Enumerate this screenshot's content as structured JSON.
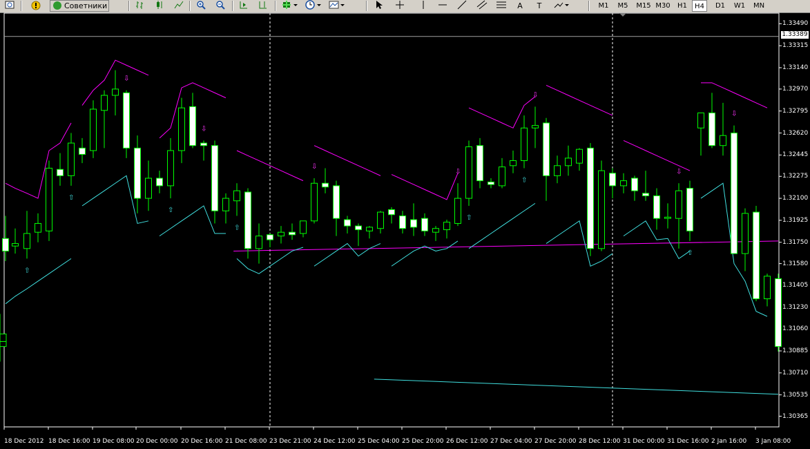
{
  "toolbar": {
    "advisors_label": "Советники",
    "buttons": [
      "zoom-in",
      "zoom-out"
    ],
    "draw_letters": [
      "A",
      "T"
    ],
    "timeframes": [
      {
        "label": "M1",
        "active": false
      },
      {
        "label": "M5",
        "active": false
      },
      {
        "label": "M15",
        "active": false
      },
      {
        "label": "M30",
        "active": false
      },
      {
        "label": "H1",
        "active": false
      },
      {
        "label": "H4",
        "active": true
      },
      {
        "label": "D1",
        "active": false
      },
      {
        "label": "W1",
        "active": false
      },
      {
        "label": "MN",
        "active": false
      }
    ]
  },
  "chart": {
    "bid_label": "1.33389",
    "price_ticks": [
      "1.33490",
      "1.33315",
      "1.33140",
      "1.32970",
      "1.32795",
      "1.32620",
      "1.32445",
      "1.32275",
      "1.32100",
      "1.31925",
      "1.31750",
      "1.31580",
      "1.31405",
      "1.31230",
      "1.31060",
      "1.30885",
      "1.30710",
      "1.30535",
      "1.30365"
    ],
    "time_ticks": [
      "18 Dec 2012",
      "18 Dec 16:00",
      "19 Dec 08:00",
      "20 Dec 00:00",
      "20 Dec 16:00",
      "21 Dec 08:00",
      "23 Dec 21:00",
      "24 Dec 12:00",
      "25 Dec 04:00",
      "25 Dec 20:00",
      "26 Dec 12:00",
      "27 Dec 04:00",
      "27 Dec 20:00",
      "28 Dec 12:00",
      "31 Dec 00:00",
      "31 Dec 16:00",
      "2 Jan 16:00",
      "3 Jan 08:00"
    ],
    "colors": {
      "background": "#000000",
      "candle_body_bull": "#000000",
      "candle_body_bear": "#ffffff",
      "candle_outline": "#00ff00",
      "upper_line": "#ff00ff",
      "lower_line": "#40e0e0",
      "grid": "#ffffff"
    }
  },
  "chart_data": {
    "type": "candlestick",
    "symbol_timeframe": "H4",
    "ylim": [
      1.3028,
      1.3358
    ],
    "bid": 1.33389,
    "candles": [
      {
        "o": 1.3178,
        "h": 1.3196,
        "l": 1.316,
        "c": 1.3168
      },
      {
        "o": 1.3172,
        "h": 1.3186,
        "l": 1.3166,
        "c": 1.3174
      },
      {
        "o": 1.317,
        "h": 1.32,
        "l": 1.3162,
        "c": 1.3182
      },
      {
        "o": 1.3183,
        "h": 1.3198,
        "l": 1.3175,
        "c": 1.319
      },
      {
        "o": 1.3184,
        "h": 1.324,
        "l": 1.3176,
        "c": 1.3234
      },
      {
        "o": 1.3233,
        "h": 1.3246,
        "l": 1.322,
        "c": 1.3228
      },
      {
        "o": 1.3228,
        "h": 1.3262,
        "l": 1.322,
        "c": 1.3254
      },
      {
        "o": 1.325,
        "h": 1.3258,
        "l": 1.3238,
        "c": 1.3245
      },
      {
        "o": 1.3248,
        "h": 1.3288,
        "l": 1.3242,
        "c": 1.3281
      },
      {
        "o": 1.328,
        "h": 1.3296,
        "l": 1.325,
        "c": 1.3292
      },
      {
        "o": 1.3292,
        "h": 1.3312,
        "l": 1.3276,
        "c": 1.3297
      },
      {
        "o": 1.3294,
        "h": 1.3296,
        "l": 1.3242,
        "c": 1.325
      },
      {
        "o": 1.325,
        "h": 1.326,
        "l": 1.3198,
        "c": 1.321
      },
      {
        "o": 1.321,
        "h": 1.324,
        "l": 1.32,
        "c": 1.3226
      },
      {
        "o": 1.3226,
        "h": 1.3232,
        "l": 1.3214,
        "c": 1.322
      },
      {
        "o": 1.322,
        "h": 1.3258,
        "l": 1.321,
        "c": 1.3248
      },
      {
        "o": 1.3248,
        "h": 1.329,
        "l": 1.3238,
        "c": 1.3282
      },
      {
        "o": 1.3283,
        "h": 1.3294,
        "l": 1.325,
        "c": 1.3252
      },
      {
        "o": 1.3254,
        "h": 1.3256,
        "l": 1.324,
        "c": 1.3252
      },
      {
        "o": 1.3252,
        "h": 1.3256,
        "l": 1.319,
        "c": 1.32
      },
      {
        "o": 1.32,
        "h": 1.3214,
        "l": 1.319,
        "c": 1.321
      },
      {
        "o": 1.3208,
        "h": 1.3222,
        "l": 1.3196,
        "c": 1.3216
      },
      {
        "o": 1.3215,
        "h": 1.3218,
        "l": 1.3162,
        "c": 1.317
      },
      {
        "o": 1.317,
        "h": 1.319,
        "l": 1.3158,
        "c": 1.318
      },
      {
        "o": 1.3181,
        "h": 1.3182,
        "l": 1.3171,
        "c": 1.3177
      },
      {
        "o": 1.318,
        "h": 1.3188,
        "l": 1.3174,
        "c": 1.3183
      },
      {
        "o": 1.3183,
        "h": 1.319,
        "l": 1.3177,
        "c": 1.3181
      },
      {
        "o": 1.3182,
        "h": 1.3192,
        "l": 1.3179,
        "c": 1.3192
      },
      {
        "o": 1.3192,
        "h": 1.3226,
        "l": 1.319,
        "c": 1.3222
      },
      {
        "o": 1.3222,
        "h": 1.3234,
        "l": 1.3214,
        "c": 1.3219
      },
      {
        "o": 1.322,
        "h": 1.3224,
        "l": 1.318,
        "c": 1.3194
      },
      {
        "o": 1.3193,
        "h": 1.3196,
        "l": 1.3182,
        "c": 1.3188
      },
      {
        "o": 1.3188,
        "h": 1.319,
        "l": 1.3172,
        "c": 1.3185
      },
      {
        "o": 1.3184,
        "h": 1.3188,
        "l": 1.3178,
        "c": 1.3187
      },
      {
        "o": 1.3186,
        "h": 1.32,
        "l": 1.3182,
        "c": 1.3199
      },
      {
        "o": 1.3201,
        "h": 1.3203,
        "l": 1.319,
        "c": 1.3197
      },
      {
        "o": 1.3196,
        "h": 1.32,
        "l": 1.3182,
        "c": 1.3186
      },
      {
        "o": 1.3193,
        "h": 1.3206,
        "l": 1.318,
        "c": 1.3187
      },
      {
        "o": 1.3194,
        "h": 1.3198,
        "l": 1.318,
        "c": 1.3184
      },
      {
        "o": 1.3183,
        "h": 1.3188,
        "l": 1.3176,
        "c": 1.3186
      },
      {
        "o": 1.3185,
        "h": 1.3193,
        "l": 1.3178,
        "c": 1.3191
      },
      {
        "o": 1.319,
        "h": 1.3222,
        "l": 1.3188,
        "c": 1.321
      },
      {
        "o": 1.321,
        "h": 1.3256,
        "l": 1.3204,
        "c": 1.3251
      },
      {
        "o": 1.3252,
        "h": 1.3258,
        "l": 1.3218,
        "c": 1.3224
      },
      {
        "o": 1.3223,
        "h": 1.3226,
        "l": 1.3218,
        "c": 1.3221
      },
      {
        "o": 1.322,
        "h": 1.3242,
        "l": 1.3218,
        "c": 1.3235
      },
      {
        "o": 1.3236,
        "h": 1.3248,
        "l": 1.323,
        "c": 1.324
      },
      {
        "o": 1.324,
        "h": 1.3276,
        "l": 1.3234,
        "c": 1.3266
      },
      {
        "o": 1.3266,
        "h": 1.3283,
        "l": 1.325,
        "c": 1.3268
      },
      {
        "o": 1.327,
        "h": 1.3274,
        "l": 1.3208,
        "c": 1.3228
      },
      {
        "o": 1.3228,
        "h": 1.3244,
        "l": 1.3222,
        "c": 1.3236
      },
      {
        "o": 1.3236,
        "h": 1.3252,
        "l": 1.3228,
        "c": 1.3242
      },
      {
        "o": 1.3238,
        "h": 1.325,
        "l": 1.3232,
        "c": 1.3249
      },
      {
        "o": 1.325,
        "h": 1.3254,
        "l": 1.3164,
        "c": 1.317
      },
      {
        "o": 1.317,
        "h": 1.324,
        "l": 1.3168,
        "c": 1.3232
      },
      {
        "o": 1.323,
        "h": 1.3234,
        "l": 1.321,
        "c": 1.322
      },
      {
        "o": 1.322,
        "h": 1.323,
        "l": 1.3214,
        "c": 1.3224
      },
      {
        "o": 1.3226,
        "h": 1.3228,
        "l": 1.3208,
        "c": 1.3216
      },
      {
        "o": 1.3214,
        "h": 1.3232,
        "l": 1.3208,
        "c": 1.3212
      },
      {
        "o": 1.3212,
        "h": 1.3218,
        "l": 1.3185,
        "c": 1.3194
      },
      {
        "o": 1.3194,
        "h": 1.3206,
        "l": 1.3186,
        "c": 1.3195
      },
      {
        "o": 1.3194,
        "h": 1.3222,
        "l": 1.317,
        "c": 1.3216
      },
      {
        "o": 1.3218,
        "h": 1.3224,
        "l": 1.3176,
        "c": 1.3184
      },
      {
        "o": 1.3266,
        "h": 1.3276,
        "l": 1.3244,
        "c": 1.3278
      },
      {
        "o": 1.3278,
        "h": 1.3294,
        "l": 1.325,
        "c": 1.3252
      },
      {
        "o": 1.3252,
        "h": 1.3286,
        "l": 1.3244,
        "c": 1.326
      },
      {
        "o": 1.3262,
        "h": 1.3268,
        "l": 1.3166,
        "c": 1.3166
      },
      {
        "o": 1.3166,
        "h": 1.3202,
        "l": 1.3152,
        "c": 1.3198
      },
      {
        "o": 1.3199,
        "h": 1.3204,
        "l": 1.3128,
        "c": 1.313
      },
      {
        "o": 1.313,
        "h": 1.315,
        "l": 1.3124,
        "c": 1.3148
      },
      {
        "o": 1.3146,
        "h": 1.315,
        "l": 1.3088,
        "c": 1.3092
      },
      {
        "o": 1.3092,
        "h": 1.3104,
        "l": 1.308,
        "c": 1.3096
      },
      {
        "o": 1.3096,
        "h": 1.3118,
        "l": 1.309,
        "c": 1.3102
      }
    ],
    "candle_x": [
      8,
      22,
      39,
      55,
      71,
      87,
      103,
      119,
      135,
      151,
      167,
      183,
      199,
      215,
      231,
      247,
      263,
      279,
      295,
      311,
      327,
      343,
      359,
      375,
      391,
      407,
      423,
      439,
      455,
      471,
      487,
      503,
      519,
      535,
      551,
      567,
      583,
      599,
      615,
      631,
      647,
      663,
      679,
      695,
      711,
      727,
      743,
      759,
      775,
      791,
      807,
      823,
      839,
      855,
      871,
      887,
      903,
      919,
      935,
      951,
      967,
      983,
      999,
      1015,
      1031,
      1047,
      1063,
      1079,
      1095,
      1111,
      1127
    ]
  }
}
